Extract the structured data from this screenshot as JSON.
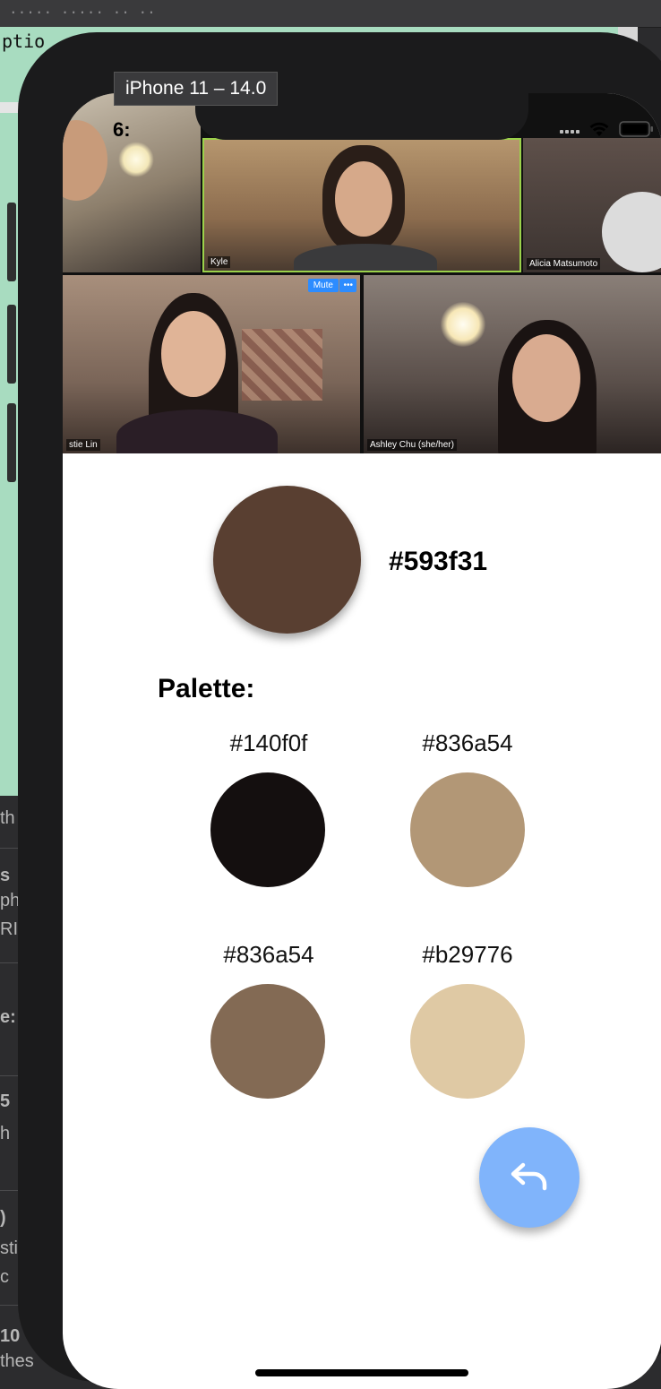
{
  "simulator": {
    "label": "iPhone 11 – 14.0"
  },
  "status_bar": {
    "time": "6:"
  },
  "video_call": {
    "participants": [
      {
        "name": "Kyle"
      },
      {
        "name": "Alicia Matsumoto"
      },
      {
        "name": "stie Lin"
      },
      {
        "name": "Ashley Chu (she/her)"
      }
    ],
    "mute_label": "Mute",
    "more_label": "•••"
  },
  "selected_color": {
    "hex": "#593f31",
    "color": "#593f31"
  },
  "palette": {
    "title": "Palette:",
    "swatches": [
      {
        "hex": "#140f0f",
        "color": "#140f0f"
      },
      {
        "hex": "#836a54",
        "color": "#b29776"
      },
      {
        "hex": "#836a54",
        "color": "#836a54"
      },
      {
        "hex": "#b29776",
        "color": "#dfc9a4"
      }
    ]
  },
  "fab": {
    "icon": "reply-icon",
    "color": "#80b4fb"
  },
  "background_ide": {
    "top_text": "ptio",
    "lower_texts": [
      "th",
      "s",
      "ph",
      "RI",
      "e:",
      "5",
      "h",
      ")",
      "sti",
      "c",
      "10",
      "thes"
    ]
  }
}
